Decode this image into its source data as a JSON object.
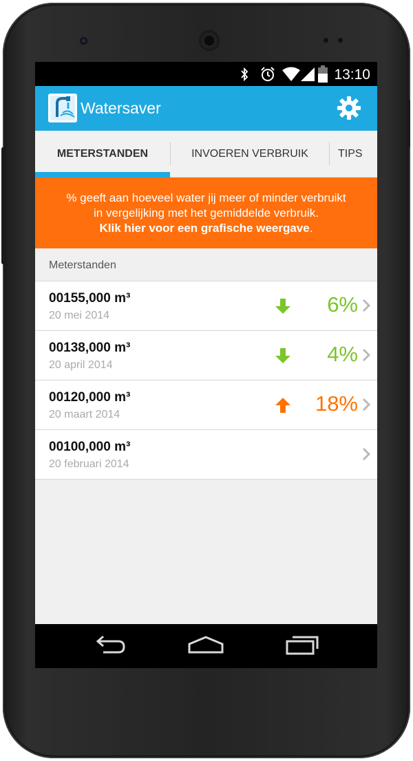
{
  "status": {
    "time": "13:10"
  },
  "app": {
    "title": "Watersaver"
  },
  "tabs": [
    {
      "label": "METERSTANDEN"
    },
    {
      "label": "INVOEREN VERBRUIK"
    },
    {
      "label": "TIPS"
    }
  ],
  "banner": {
    "line1": "% geeft aan hoeveel water jij meer of minder verbruikt",
    "line2": "in vergelijking met het gemiddelde verbruik.",
    "link": "Klik hier voor een grafische weergave",
    "link_suffix": "."
  },
  "section": {
    "title": "Meterstanden"
  },
  "readings": [
    {
      "value": "00155,000 m³",
      "date": "20 mei 2014",
      "trend": "down",
      "percent": "6%"
    },
    {
      "value": "00138,000 m³",
      "date": "20 april 2014",
      "trend": "down",
      "percent": "4%"
    },
    {
      "value": "00120,000 m³",
      "date": "20 maart 2014",
      "trend": "up",
      "percent": "18%"
    },
    {
      "value": "00100,000 m³",
      "date": "20 februari 2014",
      "trend": "",
      "percent": ""
    }
  ],
  "colors": {
    "accent": "#1fa9e1",
    "banner": "#ff6f0d",
    "down": "#7cc52a",
    "up": "#ff7300"
  },
  "icons": {
    "status": [
      "bluetooth-icon",
      "alarm-icon",
      "wifi-icon",
      "signal-icon",
      "battery-icon"
    ],
    "app_logo": "faucet-icon",
    "settings": "gear-icon",
    "nav": [
      "back-icon",
      "home-icon",
      "recents-icon"
    ]
  }
}
